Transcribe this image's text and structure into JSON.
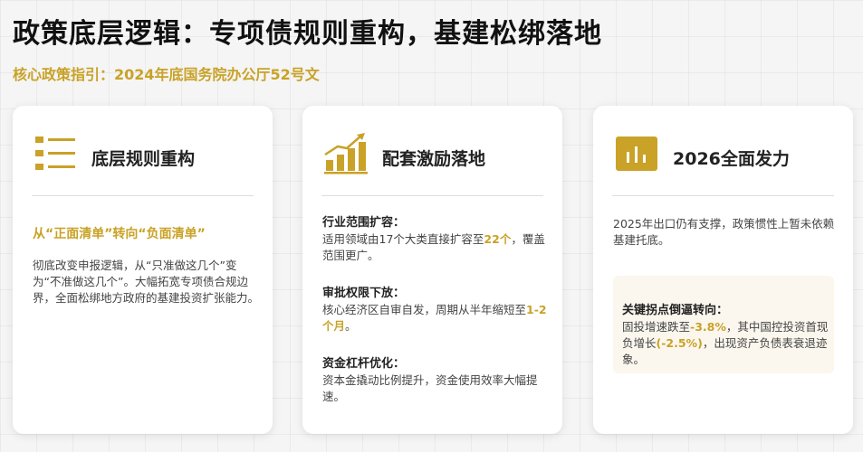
{
  "header": {
    "title": "政策底层逻辑：专项债规则重构，基建松绑落地",
    "subtitle": "核心政策指引：2024年底国务院办公厅52号文"
  },
  "cards": [
    {
      "icon": "list-icon",
      "title": "底层规则重构",
      "lead": "从“正面清单”转向“负面清单”",
      "body": "彻底改变申报逻辑，从“只准做这几个”变为“不准做这几个”。大幅拓宽专项债合规边界，全面松绑地方政府的基建投资扩张能力。"
    },
    {
      "icon": "growth-chart-icon",
      "title": "配套激励落地",
      "items": [
        {
          "title": "行业范围扩容：",
          "text_before": "适用领域由17个大类直接扩容至",
          "highlight": "22个",
          "text_after": "，覆盖范围更广。"
        },
        {
          "title": "审批权限下放：",
          "text_before": "核心经济区自审自发，周期从半年缩短至",
          "highlight": "1-2个月",
          "text_after": "。"
        },
        {
          "title": "资金杠杆优化：",
          "text_before": "资本金撬动比例提升，资金使用效率大幅提速。",
          "highlight": "",
          "text_after": ""
        }
      ]
    },
    {
      "icon": "bar-chart-icon",
      "title": "2026全面发力",
      "body": "2025年出口仍有支撑，政策惯性上暂未依赖基建托底。",
      "box": {
        "title": "关键拐点倒逼转向：",
        "t1": "固投增速跌至",
        "h1": "-3.8%",
        "t2": "，其中国控投资首现负增长",
        "h2": "(-2.5%)",
        "t3": "，出现资产负债表衰退迹象。"
      }
    }
  ],
  "colors": {
    "accent": "#c9a227",
    "text": "#222222",
    "box_bg": "#fbf7ee"
  }
}
